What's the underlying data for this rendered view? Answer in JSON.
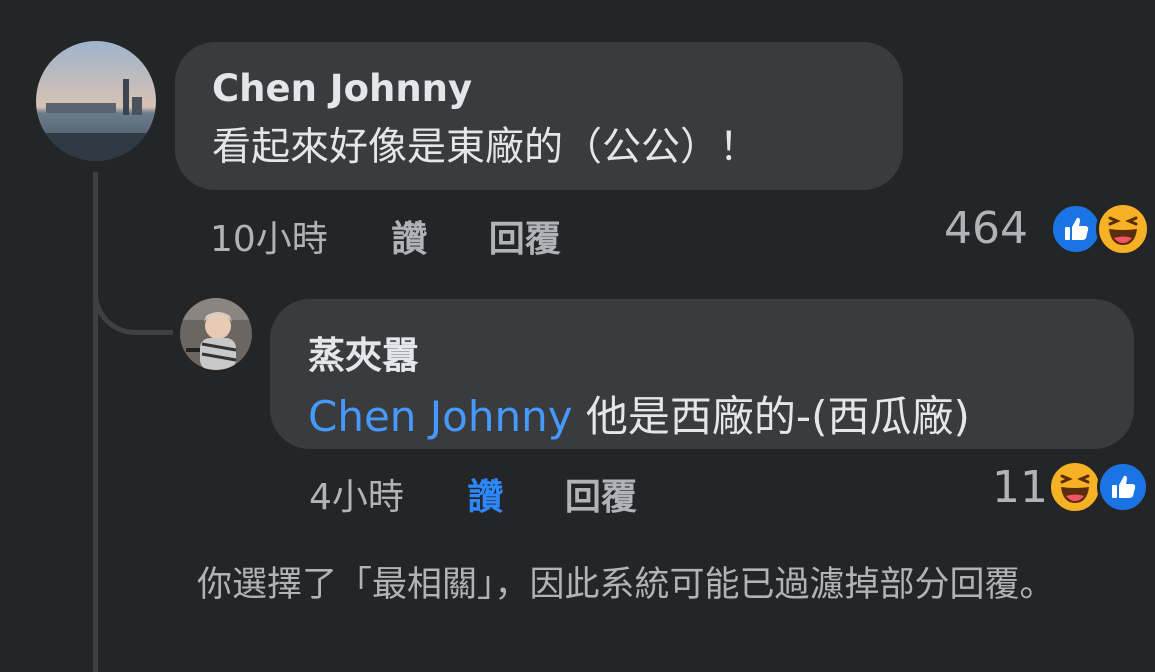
{
  "comment": {
    "author": "Chen Johnny",
    "text": "看起來好像是東廠的（公公）！",
    "time": "10小時",
    "like_label": "讚",
    "reply_label": "回覆",
    "reaction_count": "464",
    "reactions": [
      "like-icon",
      "haha-icon"
    ]
  },
  "reply": {
    "author": "蒸夾囂",
    "mention": "Chen Johnny",
    "text": " 他是西廠的-(西瓜廠)",
    "time": "4小時",
    "like_label": "讚",
    "reply_label": "回覆",
    "reaction_count": "11",
    "reactions": [
      "haha-icon",
      "like-icon"
    ]
  },
  "filter_note": "你選擇了「最相關」，因此系統可能已過濾掉部分回覆。",
  "colors": {
    "background": "#242526",
    "bubble": "#3a3b3c",
    "mention": "#4599ff",
    "like_active": "#2d88ff",
    "secondary_text": "#b0b3b8"
  }
}
